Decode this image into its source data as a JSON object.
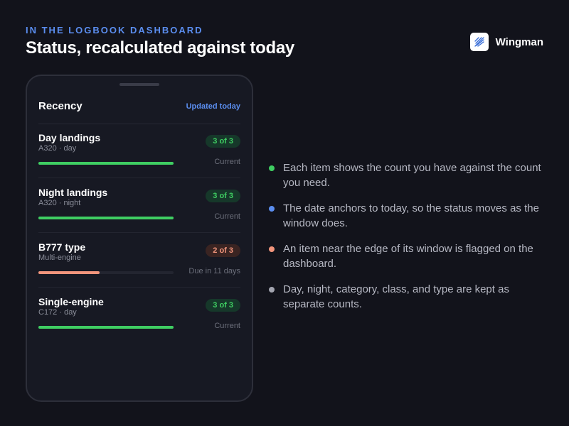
{
  "header": {
    "eyebrow": "IN THE LOGBOOK DASHBOARD",
    "headline": "Status, recalculated against today"
  },
  "brand": {
    "name": "Wingman",
    "logo_icon": "wing-icon"
  },
  "panel": {
    "title": "Recency",
    "updated": "Updated today",
    "items": [
      {
        "title": "Day landings",
        "subtitle": "A320 · day",
        "badge": "3 of 3",
        "status": "Current",
        "progress": 1.0,
        "state": "ok",
        "color": "#3fce62"
      },
      {
        "title": "Night landings",
        "subtitle": "A320 · night",
        "badge": "3 of 3",
        "status": "Current",
        "progress": 1.0,
        "state": "ok",
        "color": "#3fce62"
      },
      {
        "title": "B777 type",
        "subtitle": "Multi-engine",
        "badge": "2 of 3",
        "status": "Due in 11 days",
        "progress": 0.45,
        "state": "warn",
        "color": "#f2957c"
      },
      {
        "title": "Single-engine",
        "subtitle": "C172 · day",
        "badge": "3 of 3",
        "status": "Current",
        "progress": 1.0,
        "state": "ok",
        "color": "#3fce62"
      }
    ]
  },
  "bullets": [
    {
      "text": "Each item shows the count you have against the count you need.",
      "color": "#3fce62"
    },
    {
      "text": "The date anchors to today, so the status moves as the window does.",
      "color": "#5b8ef0"
    },
    {
      "text": "An item near the edge of its window is flagged on the dashboard.",
      "color": "#f2957c"
    },
    {
      "text": "Day, night, category, class, and type are kept as separate counts.",
      "color": "#a3a5b0"
    }
  ],
  "colors": {
    "accent": "#5b8ef0",
    "current": "#3fce62",
    "warning": "#f2957c",
    "background": "#12131b"
  }
}
